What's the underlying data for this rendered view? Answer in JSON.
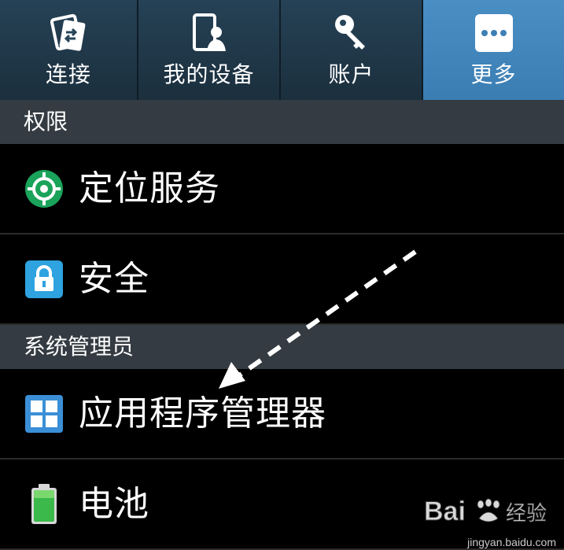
{
  "tabs": [
    {
      "label": "连接",
      "icon": "connection-icon",
      "active": false
    },
    {
      "label": "我的设备",
      "icon": "device-icon",
      "active": false
    },
    {
      "label": "账户",
      "icon": "key-icon",
      "active": false
    },
    {
      "label": "更多",
      "icon": "more-icon",
      "active": true
    }
  ],
  "sections": {
    "permissions": "权限",
    "system_admin": "系统管理员"
  },
  "items": {
    "location": {
      "label": "定位服务",
      "icon": "location-icon"
    },
    "security": {
      "label": "安全",
      "icon": "lock-icon"
    },
    "app_manager": {
      "label": "应用程序管理器",
      "icon": "grid-icon"
    },
    "battery": {
      "label": "电池",
      "icon": "battery-icon"
    }
  },
  "watermark": {
    "logo_text": "Bai du 经验",
    "site": "jingyan.baidu.com"
  },
  "colors": {
    "active_tab": "#3d80b6",
    "section_bg": "#343b42",
    "accent_green": "#1aa35a"
  }
}
